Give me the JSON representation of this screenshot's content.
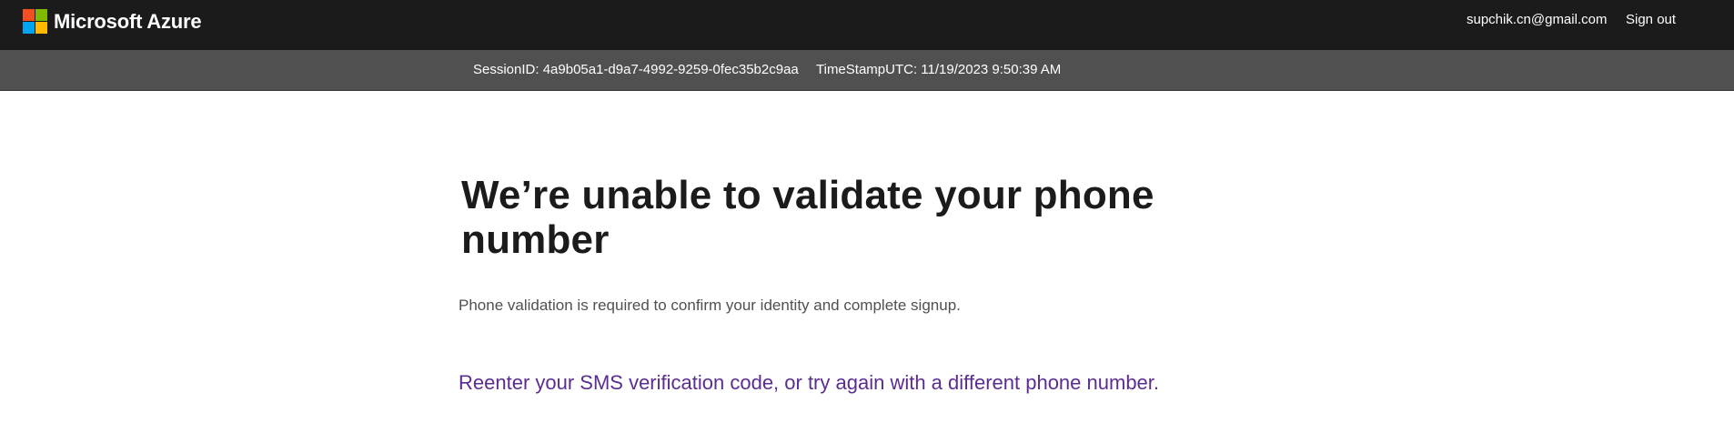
{
  "header": {
    "brand": "Microsoft Azure",
    "logo_colors": [
      "#f25022",
      "#7fba00",
      "#00a4ef",
      "#ffb900"
    ],
    "user_email": "supchik.cn@gmail.com",
    "sign_out_label": "Sign out"
  },
  "session_bar": {
    "session_id": "SessionID: 4a9b05a1-d9a7-4992-9259-0fec35b2c9aa",
    "timestamp": "TimeStampUTC: 11/19/2023 9:50:39 AM"
  },
  "main": {
    "title": "We’re unable to validate your phone number",
    "subtitle": "Phone validation is required to confirm your identity and complete signup.",
    "retry_link": "Reenter your SMS verification code, or try again with a different phone number."
  },
  "colors": {
    "topbar_bg": "#1b1b1b",
    "session_bar_bg": "#505050",
    "link": "#5c2d91"
  }
}
